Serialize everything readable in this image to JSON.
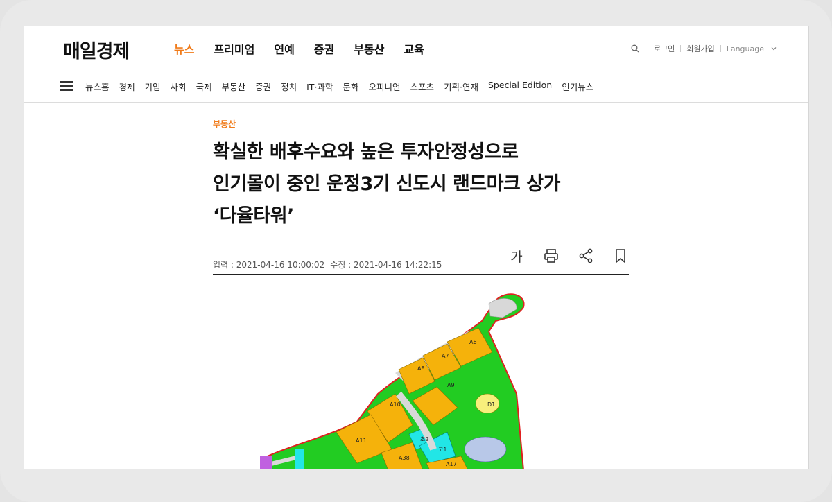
{
  "site": {
    "logo": "매일경제"
  },
  "main_nav": [
    {
      "label": "뉴스",
      "active": true
    },
    {
      "label": "프리미엄"
    },
    {
      "label": "연예"
    },
    {
      "label": "증권"
    },
    {
      "label": "부동산"
    },
    {
      "label": "교육"
    }
  ],
  "utility": {
    "login": "로그인",
    "signup": "회원가입",
    "language": "Language"
  },
  "sub_nav": [
    "뉴스홈",
    "경제",
    "기업",
    "사회",
    "국제",
    "부동산",
    "증권",
    "정치",
    "IT·과학",
    "문화",
    "오피니언",
    "스포츠",
    "기획·연재",
    "Special Edition",
    "인기뉴스"
  ],
  "article": {
    "category": "부동산",
    "headline_lines": [
      "확실한 배후수요와 높은 투자안정성으로",
      "인기몰이 중인 운정3기 신도시 랜드마크 상가",
      "‘다율타워’"
    ],
    "meta": {
      "input": "입력 : 2021-04-16 10:00:02",
      "modified": "수정 : 2021-04-16 14:22:15"
    },
    "font_size_button": "가"
  },
  "map_labels": [
    "A6",
    "A7",
    "A8",
    "A9",
    "D1",
    "A10",
    "A11",
    "초2",
    "고1",
    "A38",
    "A17"
  ],
  "colors": {
    "accent": "#f07b1a",
    "residential": "#f5b20b",
    "green": "#22cc22",
    "school": "#22e6e6",
    "boundary": "#e02020"
  },
  "icons": [
    "search-icon",
    "chevron-down-icon",
    "hamburger-icon",
    "print-icon",
    "share-icon",
    "bookmark-icon"
  ]
}
